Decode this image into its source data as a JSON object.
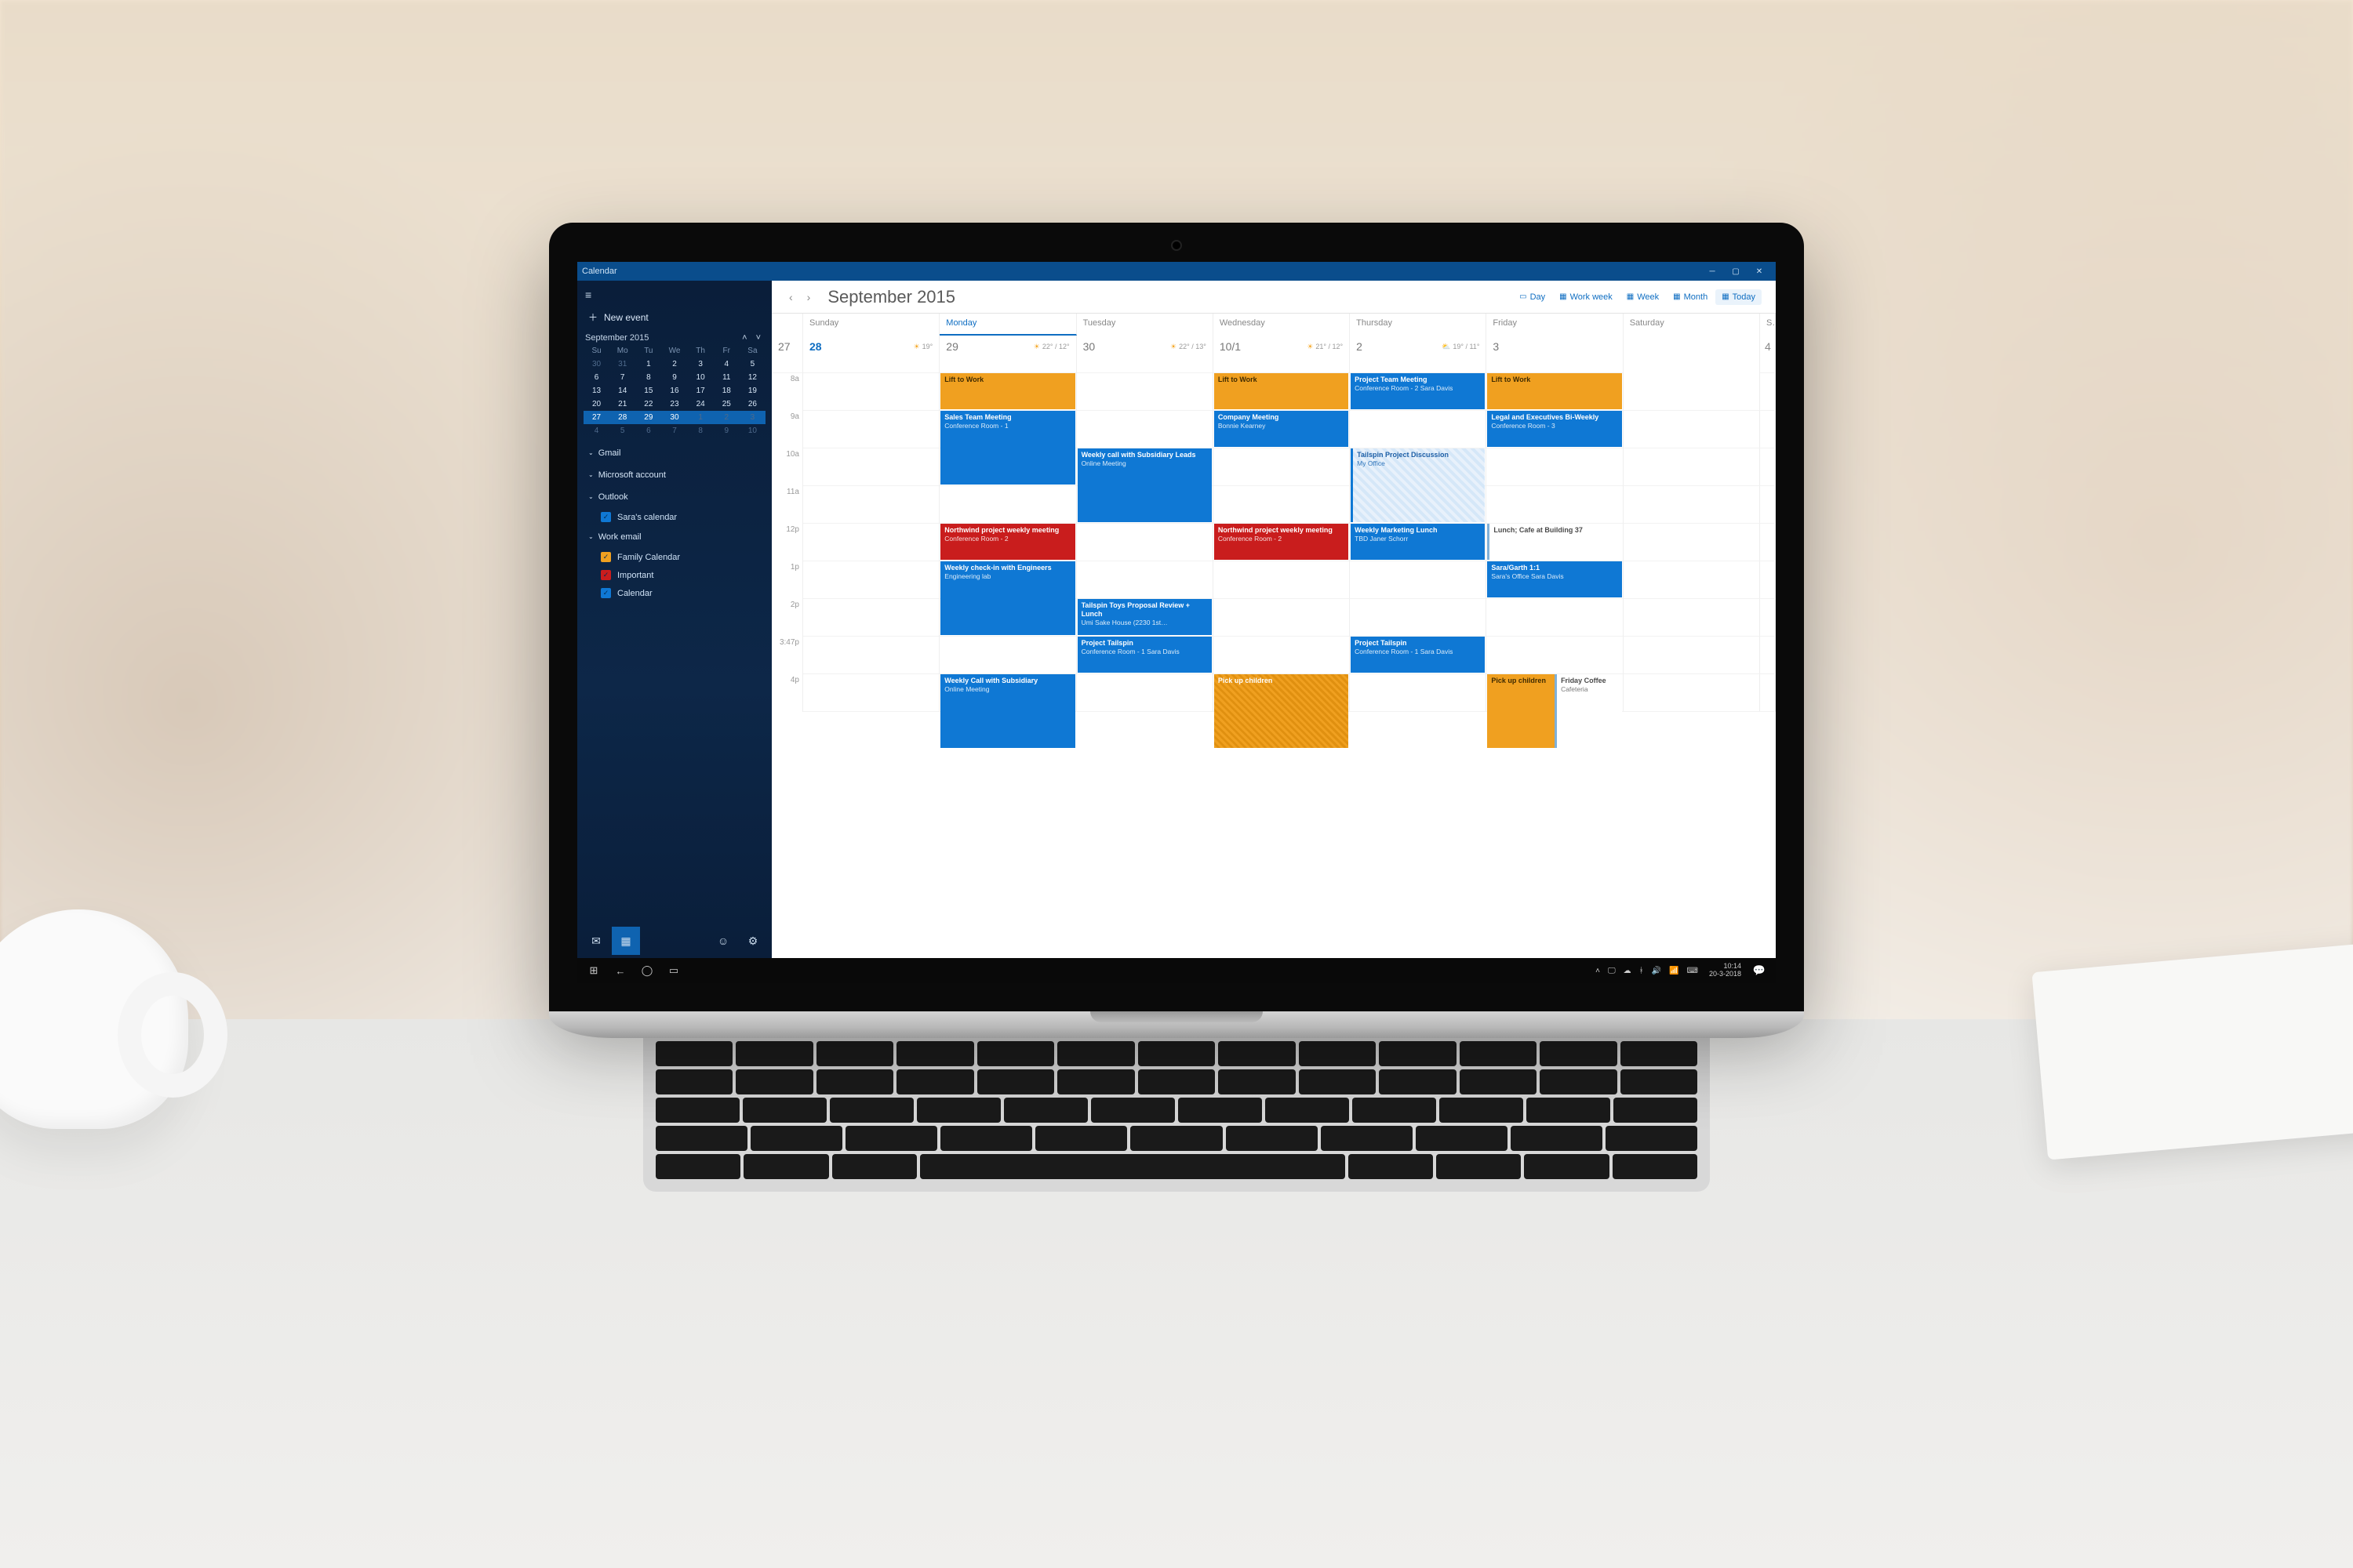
{
  "window": {
    "title": "Calendar"
  },
  "sidebar": {
    "new_event": "New event",
    "mini": {
      "label": "September 2015",
      "dow": [
        "Su",
        "Mo",
        "Tu",
        "We",
        "Th",
        "Fr",
        "Sa"
      ],
      "rows": [
        [
          "30",
          "31",
          "1",
          "2",
          "3",
          "4",
          "5"
        ],
        [
          "6",
          "7",
          "8",
          "9",
          "10",
          "11",
          "12"
        ],
        [
          "13",
          "14",
          "15",
          "16",
          "17",
          "18",
          "19"
        ],
        [
          "20",
          "21",
          "22",
          "23",
          "24",
          "25",
          "26"
        ],
        [
          "27",
          "28",
          "29",
          "30",
          "1",
          "2",
          "3"
        ],
        [
          "4",
          "5",
          "6",
          "7",
          "8",
          "9",
          "10"
        ]
      ],
      "selected_row": 4
    },
    "accounts": [
      {
        "name": "Gmail",
        "expanded": false
      },
      {
        "name": "Microsoft account",
        "expanded": false
      },
      {
        "name": "Outlook",
        "expanded": true,
        "calendars": [
          {
            "label": "Sara's calendar",
            "color": "#0f78d4",
            "checked": true
          }
        ]
      },
      {
        "name": "Work email",
        "expanded": true,
        "calendars": [
          {
            "label": "Family Calendar",
            "color": "#f0a020",
            "checked": true
          },
          {
            "label": "Important",
            "color": "#c91d1d",
            "checked": true
          },
          {
            "label": "Calendar",
            "color": "#0f78d4",
            "checked": true
          }
        ]
      }
    ]
  },
  "toolbar": {
    "month": "September 2015",
    "views": {
      "day": "Day",
      "workweek": "Work week",
      "week": "Week",
      "month": "Month",
      "today": "Today"
    }
  },
  "day_headers": [
    "Sunday",
    "Monday",
    "Tuesday",
    "Wednesday",
    "Thursday",
    "Friday",
    "Saturday"
  ],
  "dates": [
    "27",
    "28",
    "29",
    "30",
    "10/1",
    "2",
    "3",
    "4"
  ],
  "today_index": 1,
  "weather": {
    "1": {
      "icon": "sun",
      "temp": "19°"
    },
    "2": {
      "icon": "sun",
      "temp": "22° / 12°"
    },
    "3": {
      "icon": "sun",
      "temp": "22° / 13°"
    },
    "4": {
      "icon": "sun",
      "temp": "21° / 12°"
    },
    "5": {
      "icon": "cloud",
      "temp": "19° / 11°"
    }
  },
  "time_labels": [
    "8a",
    "9a",
    "10a",
    "11a",
    "12p",
    "1p",
    "2p",
    "3:47p",
    "4p"
  ],
  "events": [
    {
      "day": 1,
      "row": 0,
      "span": 1,
      "color": "orange",
      "title": "Lift to Work",
      "sub": ""
    },
    {
      "day": 1,
      "row": 1,
      "span": 2,
      "color": "blue",
      "title": "Sales Team Meeting",
      "sub": "Conference Room - 1"
    },
    {
      "day": 1,
      "row": 4,
      "span": 1,
      "color": "red",
      "title": "Northwind project weekly meeting",
      "sub": "Conference Room - 2"
    },
    {
      "day": 1,
      "row": 5,
      "span": 2,
      "color": "blue",
      "title": "Weekly check-in with Engineers",
      "sub": "Engineering lab"
    },
    {
      "day": 1,
      "row": 8,
      "span": 2,
      "color": "blue",
      "title": "Weekly Call with Subsidiary",
      "sub": "Online Meeting"
    },
    {
      "day": 2,
      "row": 2,
      "span": 2,
      "color": "blue",
      "title": "Weekly call with Subsidiary Leads",
      "sub": "Online Meeting"
    },
    {
      "day": 2,
      "row": 6,
      "span": 1,
      "color": "blue",
      "title": "Tailspin Toys Proposal Review + Lunch",
      "sub": "Umi Sake House (2230 1st…"
    },
    {
      "day": 2,
      "row": 7,
      "span": 1,
      "color": "blue",
      "title": "Project Tailspin",
      "sub": "Conference Room - 1\nSara Davis"
    },
    {
      "day": 3,
      "row": 0,
      "span": 1,
      "color": "orange",
      "title": "Lift to Work",
      "sub": ""
    },
    {
      "day": 3,
      "row": 1,
      "span": 1,
      "color": "blue",
      "title": "Company Meeting",
      "sub": "Bonnie Kearney"
    },
    {
      "day": 3,
      "row": 4,
      "span": 1,
      "color": "red",
      "title": "Northwind project weekly meeting",
      "sub": "Conference Room - 2"
    },
    {
      "day": 3,
      "row": 8,
      "span": 2,
      "color": "hatch",
      "title": "Pick up children",
      "sub": ""
    },
    {
      "day": 4,
      "row": 0,
      "span": 1,
      "color": "blue",
      "title": "Project Team Meeting",
      "sub": "Conference Room - 2\nSara Davis"
    },
    {
      "day": 4,
      "row": 2,
      "span": 2,
      "color": "tent",
      "title": "Tailspin Project Discussion",
      "sub": "My Office"
    },
    {
      "day": 4,
      "row": 4,
      "span": 1,
      "color": "blue",
      "title": "Weekly Marketing Lunch",
      "sub": "TBD\nJaner Schorr"
    },
    {
      "day": 4,
      "row": 7,
      "span": 1,
      "color": "blue",
      "title": "Project Tailspin",
      "sub": "Conference Room - 1\nSara Davis"
    },
    {
      "day": 5,
      "row": 0,
      "span": 1,
      "color": "orange",
      "title": "Lift to Work",
      "sub": ""
    },
    {
      "day": 5,
      "row": 1,
      "span": 1,
      "color": "blue",
      "title": "Legal and Executives Bi-Weekly",
      "sub": "Conference Room - 3"
    },
    {
      "day": 5,
      "row": 4,
      "span": 1,
      "color": "plain",
      "title": "Lunch; Cafe at Building 37",
      "sub": ""
    },
    {
      "day": 5,
      "row": 5,
      "span": 1,
      "color": "blue",
      "title": "Sara/Garth 1:1",
      "sub": "Sara's Office\nSara Davis"
    },
    {
      "day": 5,
      "row": 8,
      "span": 2,
      "color": "orange",
      "title": "Pick up children",
      "sub": ""
    },
    {
      "day": 5,
      "row": 8,
      "span": 2,
      "half": true,
      "color": "plain",
      "title": "Friday Coffee",
      "sub": "Cafeteria"
    }
  ],
  "taskbar": {
    "time": "10:14",
    "date": "20-3-2018"
  }
}
